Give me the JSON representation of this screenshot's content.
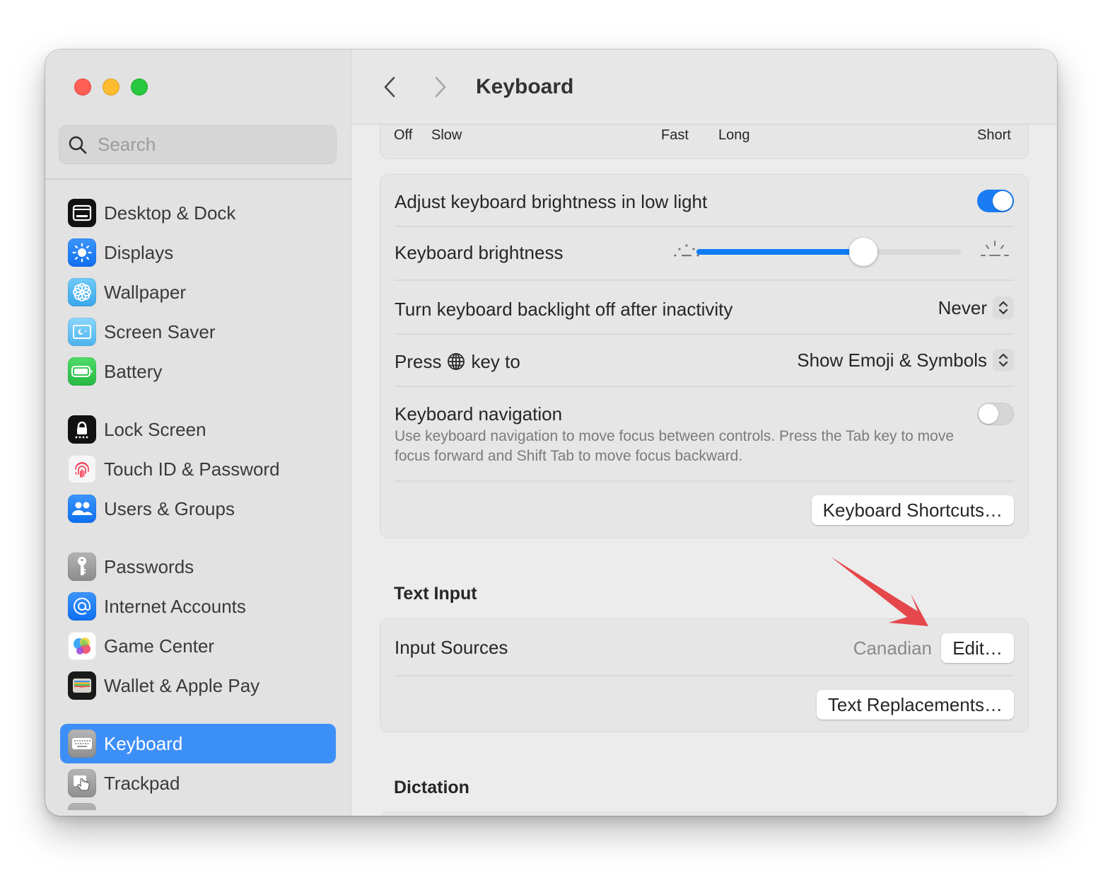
{
  "window": {
    "traffic_lights": {
      "close": "#fe5f57",
      "minimize": "#febc2e",
      "zoom": "#28c840"
    }
  },
  "sidebar": {
    "search": {
      "placeholder": "Search",
      "value": "",
      "icon": "magnifier-icon"
    },
    "groups": [
      [
        {
          "label": "Desktop & Dock",
          "icon": "desktop-dock-icon",
          "color": "#111111"
        },
        {
          "label": "Displays",
          "icon": "sun-icon",
          "color": "#1e7cf4"
        },
        {
          "label": "Wallpaper",
          "icon": "flower-icon",
          "color": "#54b8f0"
        },
        {
          "label": "Screen Saver",
          "icon": "screen-saver-icon",
          "color": "#6cc5f3"
        },
        {
          "label": "Battery",
          "icon": "battery-icon",
          "color": "#34c74f"
        }
      ],
      [
        {
          "label": "Lock Screen",
          "icon": "lock-icon",
          "color": "#111111"
        },
        {
          "label": "Touch ID & Password",
          "icon": "fingerprint-icon",
          "color": "#f6f6f6"
        },
        {
          "label": "Users & Groups",
          "icon": "users-icon",
          "color": "#1e7cf4"
        }
      ],
      [
        {
          "label": "Passwords",
          "icon": "key-icon",
          "color": "#9a9a9a"
        },
        {
          "label": "Internet Accounts",
          "icon": "at-sign-icon",
          "color": "#1e7cf4"
        },
        {
          "label": "Game Center",
          "icon": "game-center-icon",
          "color": "#ffffff"
        },
        {
          "label": "Wallet & Apple Pay",
          "icon": "wallet-icon",
          "color": "#1a1a1a"
        }
      ],
      [
        {
          "label": "Keyboard",
          "icon": "keyboard-icon",
          "color": "#9a9a9a",
          "selected": true
        },
        {
          "label": "Trackpad",
          "icon": "trackpad-icon",
          "color": "#9a9a9a"
        }
      ]
    ],
    "selected_color": "#3d8ff8"
  },
  "toolbar": {
    "back_icon": "chevron-left-icon",
    "forward_icon": "chevron-right-icon",
    "title": "Keyboard"
  },
  "main": {
    "repeat_slider_labels": {
      "key_repeat_rate": {
        "min": "Off",
        "low": "Slow",
        "max": "Fast"
      },
      "delay_until_repeat": {
        "min": "Long",
        "max": "Short"
      }
    },
    "keyboard_card": {
      "adjust_brightness": {
        "label": "Adjust keyboard brightness in low light",
        "on": true
      },
      "brightness": {
        "label": "Keyboard brightness",
        "value": 0.63,
        "min_icon": "brightness-low-icon",
        "max_icon": "brightness-high-icon"
      },
      "backlight_off": {
        "label": "Turn keyboard backlight off after inactivity",
        "value": "Never"
      },
      "press_key": {
        "label_prefix": "Press",
        "key_icon": "globe-icon",
        "label_suffix": "key to",
        "value": "Show Emoji & Symbols"
      },
      "keyboard_navigation": {
        "label": "Keyboard navigation",
        "on": false,
        "description": "Use keyboard navigation to move focus between controls. Press the Tab key to move focus forward and Shift Tab to move focus backward."
      },
      "shortcuts_button": "Keyboard Shortcuts…"
    },
    "text_input": {
      "section_title": "Text Input",
      "input_sources": {
        "label": "Input Sources",
        "value": "Canadian",
        "button": "Edit…"
      },
      "text_replacements_button": "Text Replacements…"
    },
    "dictation": {
      "section_title": "Dictation"
    },
    "accent_color": "#1a7cf5",
    "annotation_arrow_color": "#e5474b"
  }
}
